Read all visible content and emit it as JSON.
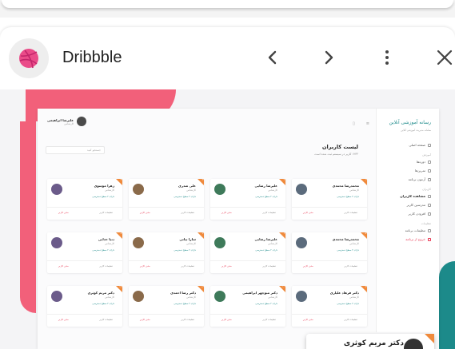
{
  "app": {
    "title": "Dribbble",
    "logo_icon": "dribbble-icon",
    "accent": "#ea4c89"
  },
  "header_actions": [
    "back-icon",
    "forward-icon",
    "more-vertical-icon",
    "close-icon"
  ],
  "mock": {
    "brand": "رسانه آموزشی آنلاین",
    "brand_sub": "سامانه مدیریت آموزشی آنلاین",
    "user_name": "علیرضا ابراهیمی",
    "user_role": "کارشناس",
    "page_title": "لیست کاربران",
    "page_subtitle": "۱۲۳۴ کاربر در سیستم ثبت شده است",
    "search_placeholder": "جستجو کنید",
    "sidebar": [
      {
        "label": "صفحه اصلی",
        "section": ""
      },
      {
        "label": "دوره‌ها",
        "section": "آموزش"
      },
      {
        "label": "تمرین‌ها",
        "section": ""
      },
      {
        "label": "آزمون برنامه",
        "section": ""
      },
      {
        "label": "مشاهده کاربران",
        "section": "کاربران",
        "active": true
      },
      {
        "label": "مدرسین کاربر",
        "section": ""
      },
      {
        "label": "افزودن کاربر",
        "section": ""
      },
      {
        "label": "تنظیمات برنامه",
        "section": "تنظیمات"
      },
      {
        "label": "خروج از برنامه",
        "section": "",
        "logout": true
      }
    ],
    "card_actions": {
      "edit": "تنظیمات کاربر",
      "delete": "حذف کاربر"
    },
    "cards": [
      {
        "name": "محمدرضا محمدی",
        "role": "کارشناس",
        "tag": "دارای ۲ سطح دسترسی",
        "num": "۱"
      },
      {
        "name": "علیرضا رضایی",
        "role": "کارشناس",
        "tag": "دارای ۲ سطح دسترسی",
        "num": "۲"
      },
      {
        "name": "علی صدری",
        "role": "کارشناس",
        "tag": "دارای ۲ سطح دسترسی",
        "num": "۳"
      },
      {
        "name": "زهرا موسوی",
        "role": "کارشناس",
        "tag": "دارای ۲ سطح دسترسی",
        "num": "۴"
      },
      {
        "name": "محمدرضا محمدی",
        "role": "کارشناس",
        "tag": "دارای ۲ سطح دسترسی",
        "num": "۵"
      },
      {
        "name": "علیرضا رضایی",
        "role": "کارشناس",
        "tag": "دارای ۲ سطح دسترسی",
        "num": "۶"
      },
      {
        "name": "سارا بیاتی",
        "role": "کارشناس",
        "tag": "دارای ۲ سطح دسترسی",
        "num": "۷"
      },
      {
        "name": "دنیا خدایی",
        "role": "کارشناس",
        "tag": "دارای ۲ سطح دسترسی",
        "num": "۸"
      },
      {
        "name": "دکتر فرهاد علیاری",
        "role": "کارشناس",
        "tag": "دارای ۲ سطح دسترسی",
        "num": "۹"
      },
      {
        "name": "دکتر منوچهر ابراهیمی",
        "role": "کارشناس",
        "tag": "دارای ۲ سطح دسترسی",
        "num": "۱۰"
      },
      {
        "name": "دکتر رضا احمدی",
        "role": "کارشناس",
        "tag": "دارای ۲ سطح دسترسی",
        "num": "۱۱"
      },
      {
        "name": "دکتر مریم کوثری",
        "role": "کارشناس",
        "tag": "دارای ۲ سطح دسترسی",
        "num": "۱۲"
      }
    ],
    "popup_name": "دکتر مریم کوثری"
  }
}
